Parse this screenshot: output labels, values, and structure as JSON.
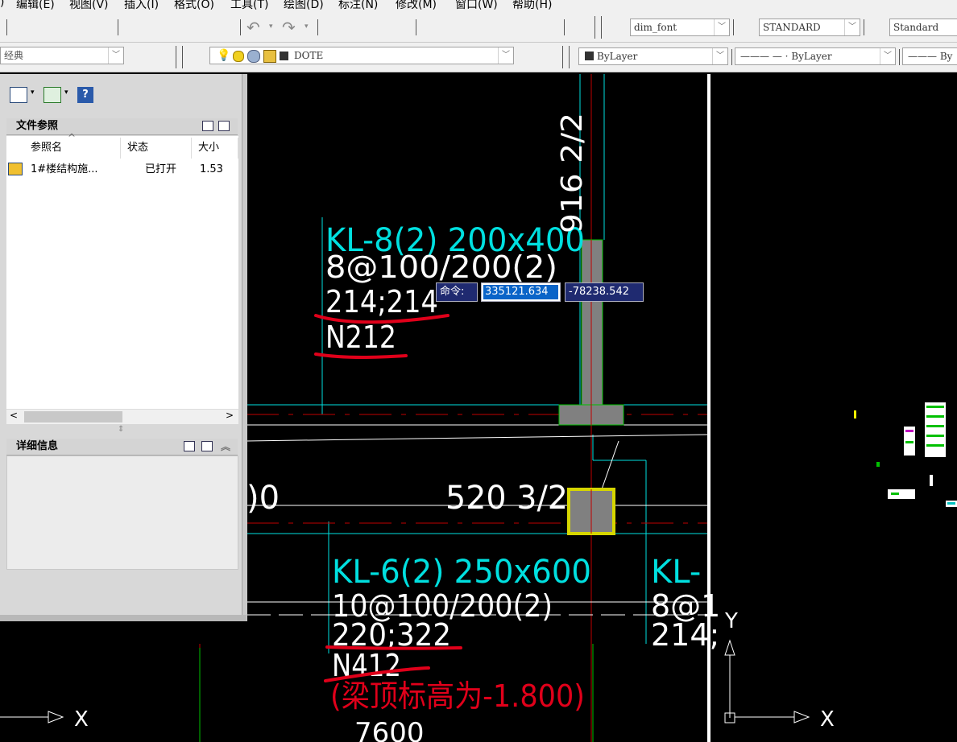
{
  "menu": {
    "items": [
      "编辑(E)",
      "视图(V)",
      "插入(I)",
      "格式(O)",
      "工具(T)",
      "绘图(D)",
      "标注(N)",
      "修改(M)",
      "窗口(W)",
      "帮助(H)"
    ]
  },
  "toolbar1": {
    "dim_style": "dim_font",
    "text_style": "STANDARD",
    "table_style": "Standard"
  },
  "toolbar2": {
    "workspace": "经典",
    "layer": "DOTE",
    "color": "ByLayer",
    "linetype": "ByLayer",
    "lineweight": "By"
  },
  "palette": {
    "file_refs_title": "文件参照",
    "columns": [
      "参照名",
      "状态",
      "大小"
    ],
    "rows": [
      {
        "name": "1#楼结构施...",
        "status": "已打开",
        "size": "1.53"
      }
    ],
    "details_title": "详细信息"
  },
  "command": {
    "label": "命令:",
    "x_value": "335121.634",
    "y_value": "-78238.542"
  },
  "drawing": {
    "beam1": {
      "title": "KL-8(2) 200x400",
      "stirrup": "8@100/200(2)",
      "rebar": "214;214",
      "torsion": "N212"
    },
    "beam2": {
      "title": "KL-6(2) 250x600",
      "stirrup": "10@100/200(2)",
      "rebar": "220;322",
      "torsion": "N412",
      "note": "(梁顶标高为-1.800)"
    },
    "beam3": {
      "title": "KL-",
      "stirrup": "8@1",
      "rebar": "214;"
    },
    "vertical_label": "916 2/2",
    "col_label": "520 3/2",
    "left_fragment": ")0",
    "bottom_fragment": "7600",
    "ucs_x": "X",
    "ucs_y": "Y"
  },
  "colors": {
    "cyan": "#00e0e0",
    "red_markup": "#e0001a",
    "yellow": "#d6d600",
    "green_line": "#00c000",
    "cmd_bg": "#1f2a70",
    "cmd_input_bg": "#ffffff",
    "cmd_input_select": "#0a64c8"
  }
}
